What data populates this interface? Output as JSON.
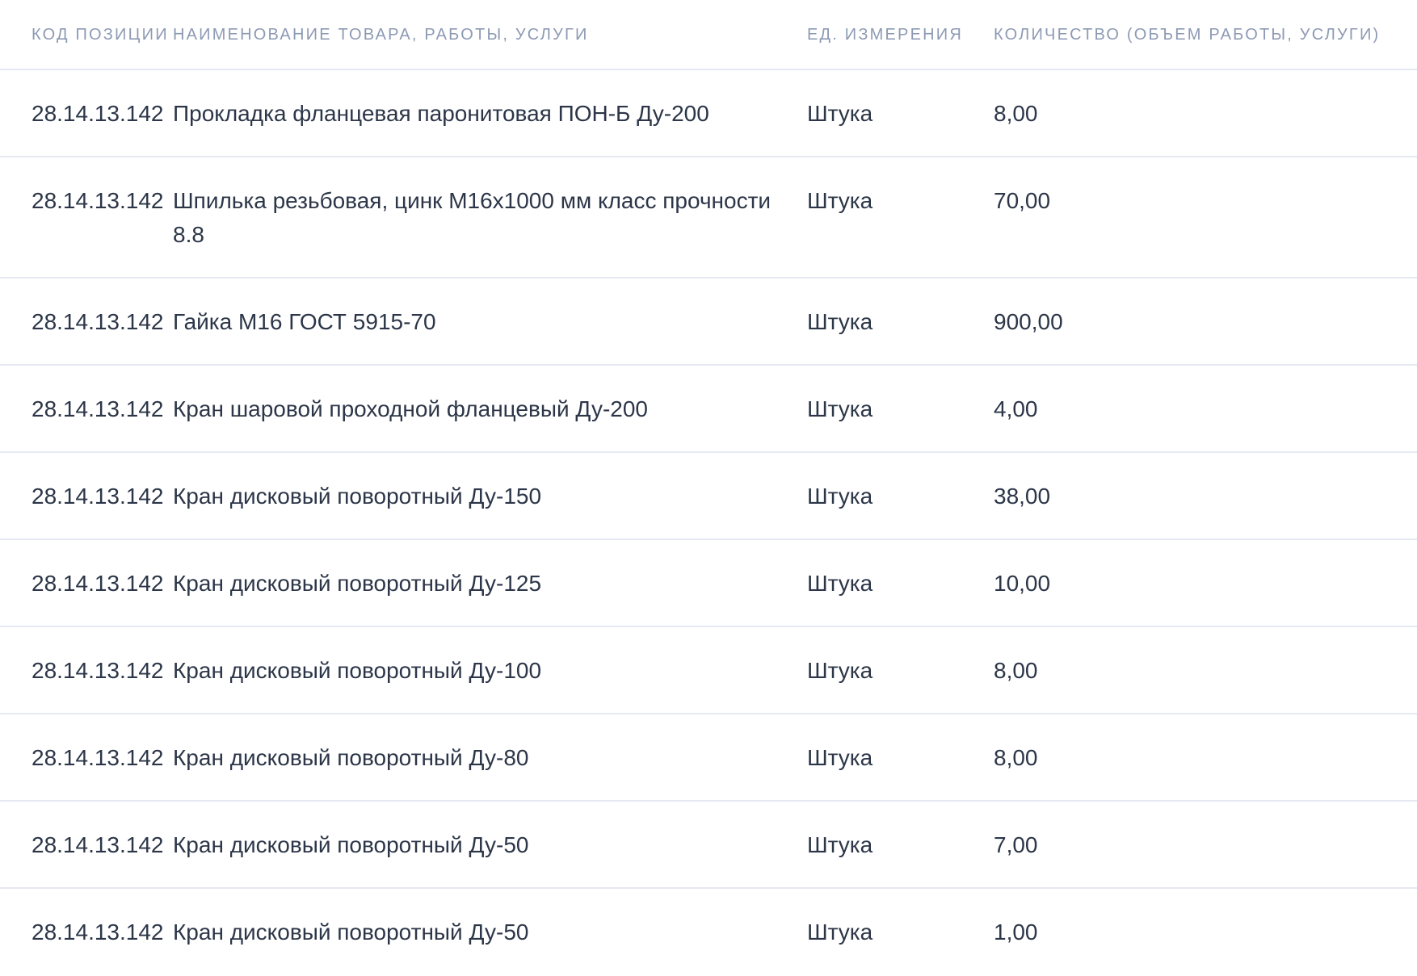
{
  "table": {
    "headers": {
      "code": "КОД ПОЗИЦИИ",
      "name": "НАИМЕНОВАНИЕ ТОВАРА, РАБОТЫ, УСЛУГИ",
      "unit": "ЕД. ИЗМЕРЕНИЯ",
      "qty": "КОЛИЧЕСТВО (ОБЪЕМ РАБОТЫ, УСЛУГИ)"
    },
    "rows": [
      {
        "code": "28.14.13.142",
        "name": "Прокладка фланцевая паронитовая ПОН-Б Ду-200",
        "unit": "Штука",
        "qty": "8,00"
      },
      {
        "code": "28.14.13.142",
        "name": "Шпилька резьбовая, цинк М16х1000 мм класс прочности 8.8",
        "unit": "Штука",
        "qty": "70,00"
      },
      {
        "code": "28.14.13.142",
        "name": "Гайка М16 ГОСТ 5915-70",
        "unit": "Штука",
        "qty": "900,00"
      },
      {
        "code": "28.14.13.142",
        "name": "Кран шаровой проходной фланцевый Ду-200",
        "unit": "Штука",
        "qty": "4,00"
      },
      {
        "code": "28.14.13.142",
        "name": "Кран дисковый поворотный Ду-150",
        "unit": "Штука",
        "qty": "38,00"
      },
      {
        "code": "28.14.13.142",
        "name": "Кран дисковый поворотный Ду-125",
        "unit": "Штука",
        "qty": "10,00"
      },
      {
        "code": "28.14.13.142",
        "name": "Кран дисковый поворотный Ду-100",
        "unit": "Штука",
        "qty": "8,00"
      },
      {
        "code": "28.14.13.142",
        "name": "Кран дисковый поворотный Ду-80",
        "unit": "Штука",
        "qty": "8,00"
      },
      {
        "code": "28.14.13.142",
        "name": "Кран дисковый поворотный Ду-50",
        "unit": "Штука",
        "qty": "7,00"
      },
      {
        "code": "28.14.13.142",
        "name": "Кран дисковый поворотный Ду-50",
        "unit": "Штука",
        "qty": "1,00"
      }
    ]
  }
}
